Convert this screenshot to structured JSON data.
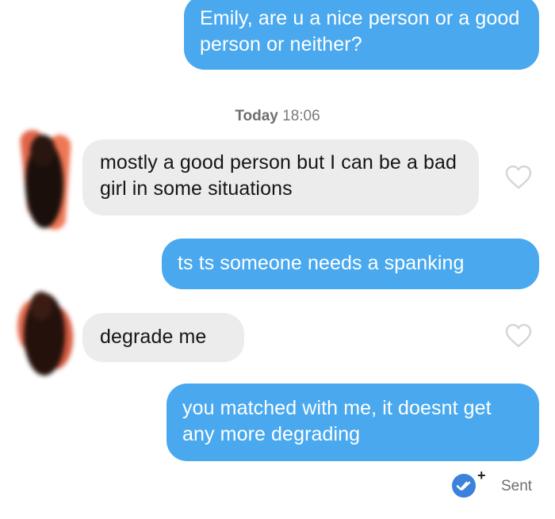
{
  "messages": [
    {
      "direction": "sent",
      "text": "Emily, are u a nice person or a good person or neither?"
    },
    {
      "direction": "received",
      "text": "mostly a good person but I can be a bad girl in some situations"
    },
    {
      "direction": "sent",
      "text": "ts ts someone needs a spanking"
    },
    {
      "direction": "received",
      "text": "degrade me"
    },
    {
      "direction": "sent",
      "text": "you matched with me, it doesnt get any more degrading"
    }
  ],
  "timestamp": {
    "day": "Today",
    "time": "18:06"
  },
  "status": {
    "label": "Sent",
    "plus": "+"
  },
  "colors": {
    "sent_bubble": "#4aa9ee",
    "received_bubble": "#ececec",
    "read_receipt": "#3b82dc"
  },
  "icons": {
    "like": "heart-outline-icon",
    "read_receipt": "double-check-icon",
    "avatar": "blurred-avatar"
  }
}
